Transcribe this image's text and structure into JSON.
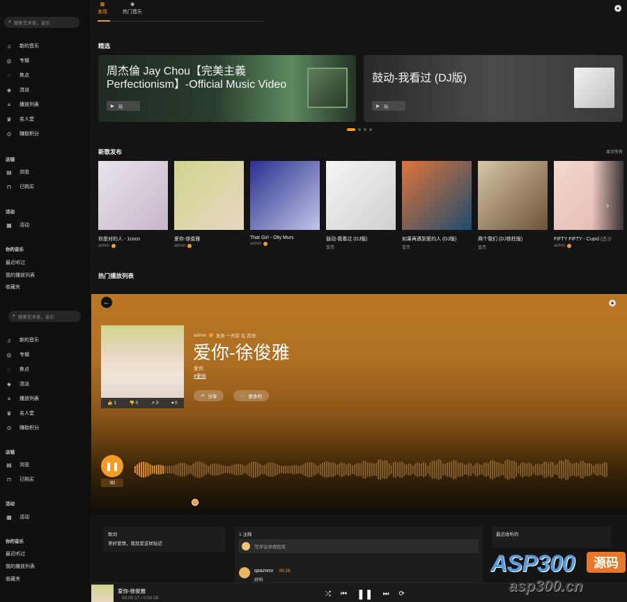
{
  "app1": {
    "sidebar": {
      "search_placeholder": "搜索艺术家，音乐",
      "nav": [
        {
          "icon": "music-note-icon",
          "label": "新的音乐"
        },
        {
          "icon": "album-icon",
          "label": "专辑"
        },
        {
          "icon": "focus-icon",
          "label": "焦点"
        },
        {
          "icon": "genre-icon",
          "label": "流派"
        },
        {
          "icon": "playlist-icon",
          "label": "播放列表"
        },
        {
          "icon": "trophy-icon",
          "label": "名人堂"
        },
        {
          "icon": "points-icon",
          "label": "赚取积分"
        }
      ],
      "store_title": "店铺",
      "store": [
        {
          "icon": "browse-icon",
          "label": "浏览"
        },
        {
          "icon": "bag-icon",
          "label": "已购买"
        }
      ],
      "activity_title": "活动",
      "activity": [
        {
          "icon": "calendar-icon",
          "label": "活动"
        }
      ],
      "my_music_title": "你的音乐",
      "my_music": [
        "最近听过",
        "我的播放列表",
        "收藏夹"
      ]
    },
    "tabs": [
      {
        "icon": "grid-icon",
        "label": "发现",
        "active": true
      },
      {
        "icon": "disc-icon",
        "label": "热门音乐",
        "active": false
      }
    ],
    "featured_title": "精选",
    "featured": [
      {
        "title": "周杰倫 Jay Chou【完美主義 Perfectionism】-Official Music Video",
        "play_label": "玩"
      },
      {
        "title": "鼓动-我看过 (DJ版)",
        "play_label": "玩"
      }
    ],
    "new_releases_title": "新歌发布",
    "see_all": "显示所有",
    "albums": [
      {
        "name": "你是对的人 - 1coco",
        "artist": "admin",
        "verified": true,
        "colors": [
          "#e9e4ec",
          "#c7b6c9"
        ]
      },
      {
        "name": "爱你-徐俊雅",
        "artist": "admin",
        "verified": true,
        "colors": [
          "#cfd58c",
          "#e8d7c3"
        ]
      },
      {
        "name": "That Girl - Olly Murs",
        "artist": "admin",
        "verified": true,
        "colors": [
          "#2b2f8f",
          "#c0c6e8"
        ]
      },
      {
        "name": "鼓动-我看过 (DJ版)",
        "artist": "富贵",
        "verified": false,
        "colors": [
          "#f5f5f5",
          "#d0d0d0"
        ]
      },
      {
        "name": "如果再遇到爱的人 (DJ版)",
        "artist": "富贵",
        "verified": false,
        "colors": [
          "#e0743a",
          "#1e4b6e"
        ]
      },
      {
        "name": "两个我们 (DJ铁柱版)",
        "artist": "富贵",
        "verified": false,
        "colors": [
          "#d8c6a6",
          "#6b5436"
        ]
      },
      {
        "name": "FIFTY FIFTY - Cupid (古沙",
        "artist": "admin",
        "verified": true,
        "colors": [
          "#f3d9d1",
          "#e4b6ae"
        ]
      }
    ],
    "hot_playlists_title": "热门播放列表"
  },
  "app2": {
    "sidebar": {
      "search_placeholder": "搜索艺术家，音乐",
      "nav": [
        {
          "icon": "music-note-icon",
          "label": "新的音乐"
        },
        {
          "icon": "album-icon",
          "label": "专辑"
        },
        {
          "icon": "focus-icon",
          "label": "焦点"
        },
        {
          "icon": "genre-icon",
          "label": "流派"
        },
        {
          "icon": "playlist-icon",
          "label": "播放列表"
        },
        {
          "icon": "trophy-icon",
          "label": "名人堂"
        },
        {
          "icon": "points-icon",
          "label": "赚取积分"
        }
      ],
      "store_title": "店铺",
      "store": [
        {
          "icon": "browse-icon",
          "label": "浏览"
        },
        {
          "icon": "bag-icon",
          "label": "已购买"
        }
      ],
      "activity_title": "活动",
      "activity": [
        {
          "icon": "calendar-icon",
          "label": "活动"
        }
      ],
      "my_music_title": "你的音乐",
      "my_music": [
        "最近听过",
        "我的播放列表",
        "收藏夹"
      ]
    },
    "song": {
      "author": "admin",
      "posted": "发表 一天前 在 其他",
      "title": "爱你-徐俊雅",
      "subtitle": "爱你",
      "tag": "#爱你",
      "likes": "1",
      "dislikes": "0",
      "shares": "3",
      "favorites": "0",
      "share_label": "分享",
      "more_label": "更多的",
      "play_count": "30",
      "progress": 0.06
    },
    "lyrics": {
      "title": "歌词",
      "text": "美好爱情，我就爱这样贴近"
    },
    "comments": {
      "title": "1 注释",
      "placeholder": "写评论并按回车",
      "items": [
        {
          "user": "qaazwsx",
          "time": "00:26",
          "text": "好听"
        }
      ]
    },
    "recent": {
      "title": "最近收听的"
    },
    "player": {
      "title": "爱你-徐俊雅",
      "time": "00:00:17 / 0:03:26"
    },
    "watermark": {
      "brand": "ASP300",
      "badge": "源码",
      "url": "asp300.cn"
    },
    "colors": {
      "accent": "#f39c28",
      "hero": "#b97725"
    }
  }
}
